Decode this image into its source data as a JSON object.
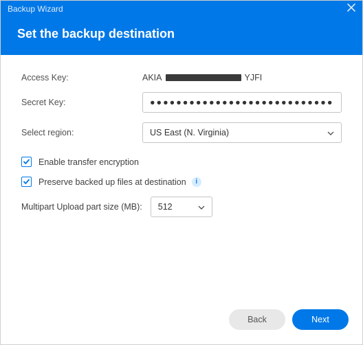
{
  "window": {
    "title": "Backup Wizard"
  },
  "header": {
    "title": "Set the backup destination"
  },
  "form": {
    "access_key": {
      "label": "Access Key:",
      "prefix": "AKIA",
      "suffix": "YJFI"
    },
    "secret_key": {
      "label": "Secret Key:",
      "masked": "●●●●●●●●●●●●●●●●●●●●●●●●●●●●●●"
    },
    "region": {
      "label": "Select region:",
      "value": "US East (N. Virginia)"
    }
  },
  "options": {
    "encrypt": {
      "label": "Enable transfer encryption",
      "checked": true
    },
    "preserve": {
      "label": "Preserve backed up files at destination",
      "checked": true
    },
    "partsize": {
      "label": "Multipart Upload part size (MB):",
      "value": "512"
    }
  },
  "buttons": {
    "back": "Back",
    "next": "Next"
  },
  "icons": {
    "info": "i"
  }
}
